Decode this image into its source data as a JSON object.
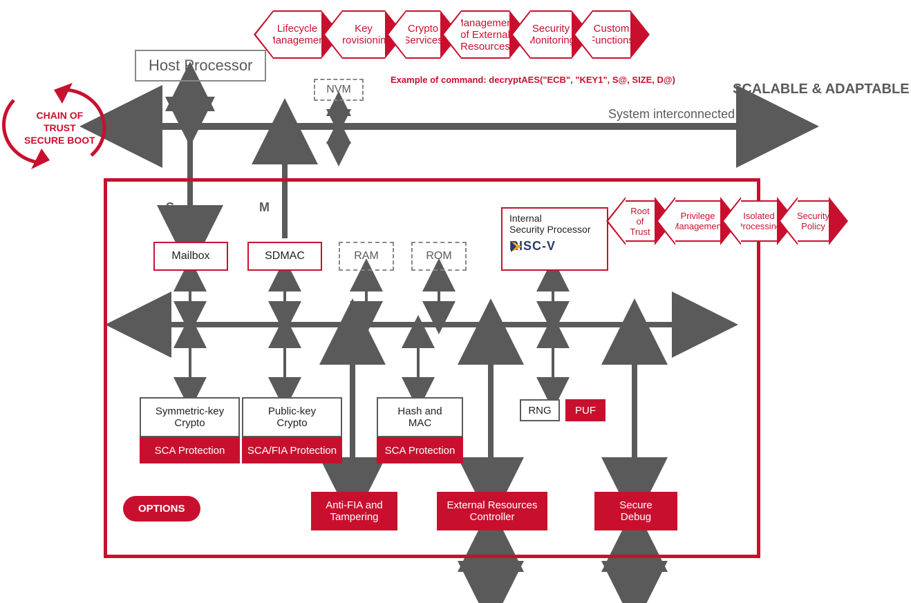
{
  "header": {
    "host_processor": "Host Processor",
    "scalable": "SCALABLE & ADAPTABLE",
    "system_interconnected": "System interconnected",
    "example_cmd": "Example of command: decryptAES(\"ECB\", \"KEY1\", S@, SIZE, D@)"
  },
  "top_hex": [
    "Lifecycle\nManagement",
    "Key\nProvisioning",
    "Crypto\nServices",
    "Management\nof External\nResources",
    "Security\nMonitoring",
    "Custom\nFunctions"
  ],
  "chain_trust": {
    "l1": "CHAIN OF",
    "l2": "TRUST",
    "l3": "SECURE BOOT"
  },
  "nvm": "NVM",
  "labels": {
    "s": "S",
    "m": "M"
  },
  "row1": {
    "mailbox": "Mailbox",
    "sdmac": "SDMAC",
    "ram": "RAM",
    "rom": "ROM",
    "isp_l1": "Internal",
    "isp_l2": "Security Processor",
    "riscv": "RISC-V"
  },
  "side_hex": [
    "Root of\nTrust",
    "Privilege\nManagement",
    "Isolated\nProcessing",
    "Security\nPolicy"
  ],
  "crypto": {
    "sym_title": "Symmetric-key\nCrypto",
    "sym_prot": "SCA Protection",
    "pub_title": "Public-key\nCrypto",
    "pub_prot": "SCA/FIA Protection",
    "hash_title": "Hash and\nMAC",
    "hash_prot": "SCA Protection"
  },
  "small": {
    "rng": "RNG",
    "puf": "PUF"
  },
  "bottom": {
    "anti_fia": "Anti-FIA and\nTampering",
    "erc": "External Resources\nController",
    "secure_debug": "Secure\nDebug"
  },
  "options": "OPTIONS"
}
